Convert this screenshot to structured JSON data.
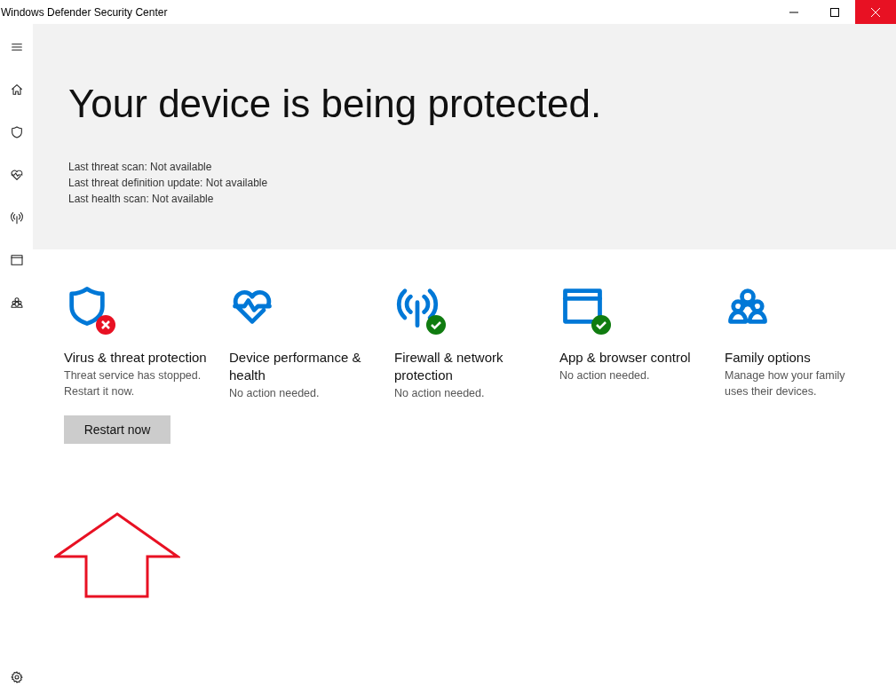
{
  "window": {
    "title": "Windows Defender Security Center"
  },
  "sidebar": {
    "items": [
      {
        "kind": "menu"
      },
      {
        "kind": "home"
      },
      {
        "kind": "shield"
      },
      {
        "kind": "health"
      },
      {
        "kind": "network"
      },
      {
        "kind": "browser"
      },
      {
        "kind": "family"
      }
    ],
    "bottom": {
      "kind": "settings"
    }
  },
  "hero": {
    "title": "Your device is being protected.",
    "details": [
      {
        "label": "Last threat scan:",
        "value": "Not available"
      },
      {
        "label": "Last threat definition update:",
        "value": "Not available"
      },
      {
        "label": "Last health scan:",
        "value": "Not available"
      }
    ]
  },
  "tiles": [
    {
      "kind": "shield",
      "badge": {
        "kind": "error"
      },
      "title": "Virus & threat protection",
      "description": "Threat service has stopped. Restart it now.",
      "button": "Restart now"
    },
    {
      "kind": "health",
      "title": "Device performance & health",
      "description": "No action needed."
    },
    {
      "kind": "network",
      "badge": {
        "kind": "ok"
      },
      "title": "Firewall & network protection",
      "description": "No action needed."
    },
    {
      "kind": "browser",
      "badge": {
        "kind": "ok"
      },
      "title": "App & browser control",
      "description": "No action needed."
    },
    {
      "kind": "family",
      "title": "Family options",
      "description": "Manage how your family uses their devices."
    }
  ]
}
